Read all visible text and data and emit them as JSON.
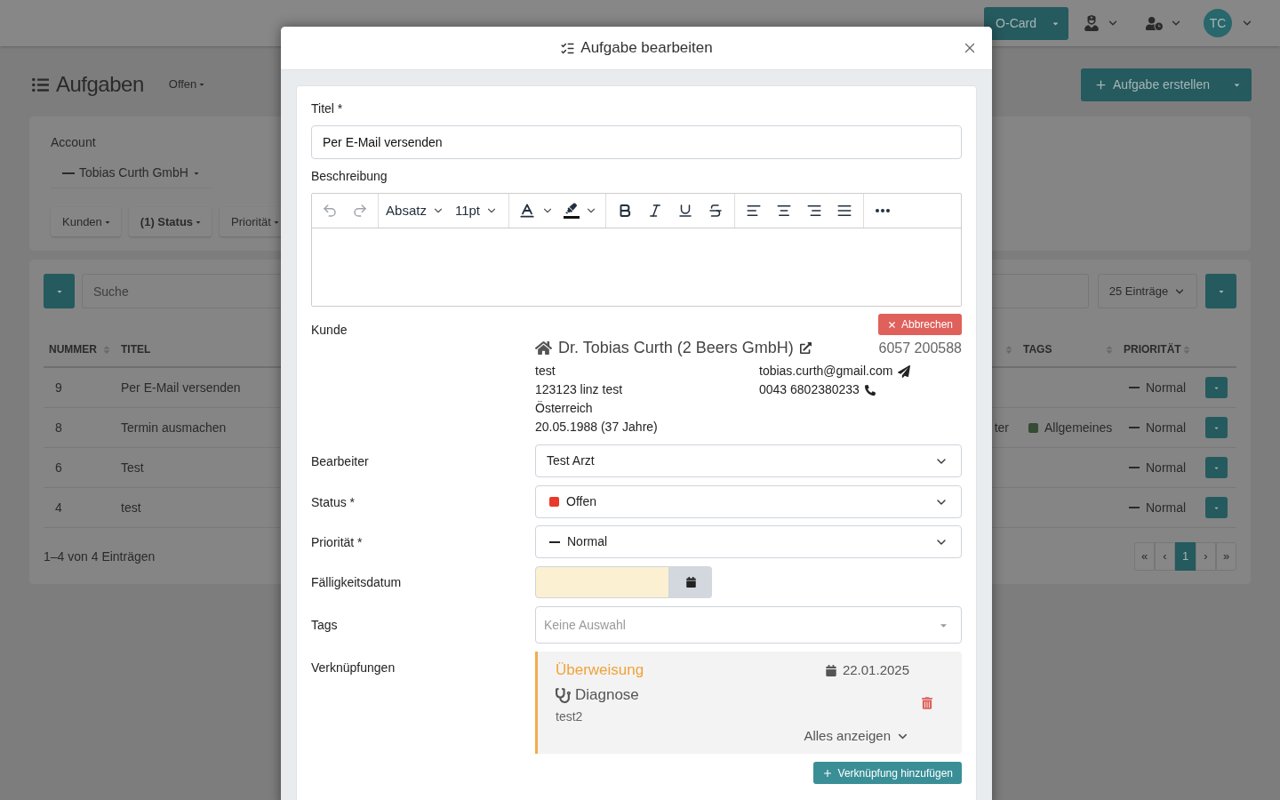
{
  "navbar": {
    "card_button": "O-Card",
    "avatar_initials": "TC"
  },
  "page_header": {
    "title": "Aufgaben",
    "view_filter": "Offen",
    "create_button": "Aufgabe erstellen"
  },
  "filters": {
    "account_label": "Account",
    "account_value": "Tobias Curth GmbH",
    "chips": [
      {
        "label": "Kunden",
        "active": false
      },
      {
        "label": "(1) Status",
        "active": true
      },
      {
        "label": "Priorität",
        "active": false
      }
    ]
  },
  "table": {
    "search_placeholder": "Suche",
    "page_size": "25 Einträge",
    "columns": [
      {
        "label": "NUMMER",
        "sortable": true
      },
      {
        "label": "TITEL",
        "sortable": false
      },
      {
        "sortable": true
      },
      {
        "label": "TAGS",
        "sortable": true
      },
      {
        "label": "PRIORITÄT",
        "sortable": true
      }
    ],
    "rows": [
      {
        "number": "9",
        "title": "Per E-Mail versenden",
        "priority": "Normal"
      },
      {
        "number": "8",
        "title": "Termin ausmachen",
        "column_3": "ter",
        "tags": [
          {
            "label": "Allgemeines",
            "color": "#344c33"
          }
        ],
        "priority": "Normal"
      },
      {
        "number": "6",
        "title": "Test",
        "priority": "Normal"
      },
      {
        "number": "4",
        "title": "test",
        "priority": "Normal"
      }
    ],
    "summary": "1–4 von 4 Einträgen",
    "pagination": [
      {
        "label": "«",
        "selected": false
      },
      {
        "label": "‹",
        "selected": false
      },
      {
        "label": "1",
        "selected": true
      },
      {
        "label": "›",
        "selected": false
      },
      {
        "label": "»",
        "selected": false
      }
    ]
  },
  "modal": {
    "title": "Aufgabe bearbeiten",
    "title_field": {
      "label": "Titel *",
      "value": "Per E-Mail versenden"
    },
    "description": {
      "label": "Beschreibung",
      "toolbar": {
        "undo": {
          "disabled": true
        },
        "redo": {
          "disabled": true
        },
        "block_format": "Absatz",
        "font_size": "11pt"
      }
    },
    "customer": {
      "label": "Kunde",
      "cancel_button": "Abbrechen",
      "name": "Dr. Tobias Curth (2 Beers GmbH)",
      "number": "6057 200588",
      "address_lines": [
        "test",
        "123123 linz test",
        "Österreich",
        "20.05.1988 (37 Jahre)"
      ],
      "email": "tobias.curth@gmail.com",
      "phone": "0043 6802380233"
    },
    "assignee": {
      "label": "Bearbeiter",
      "value": "Test Arzt"
    },
    "status": {
      "label": "Status *",
      "value": "Offen"
    },
    "priority": {
      "label": "Priorität *",
      "value": "Normal"
    },
    "due_date": {
      "label": "Fälligkeitsdatum"
    },
    "tags": {
      "label": "Tags",
      "placeholder": "Keine Auswahl"
    },
    "links": {
      "label": "Verknüpfungen",
      "items": [
        {
          "type": "Überweisung",
          "date": "22.01.2025",
          "category": "Diagnose",
          "note": "test2",
          "expand_label": "Alles anzeigen"
        }
      ],
      "add_button": "Verknüpfung hinzufügen"
    }
  }
}
